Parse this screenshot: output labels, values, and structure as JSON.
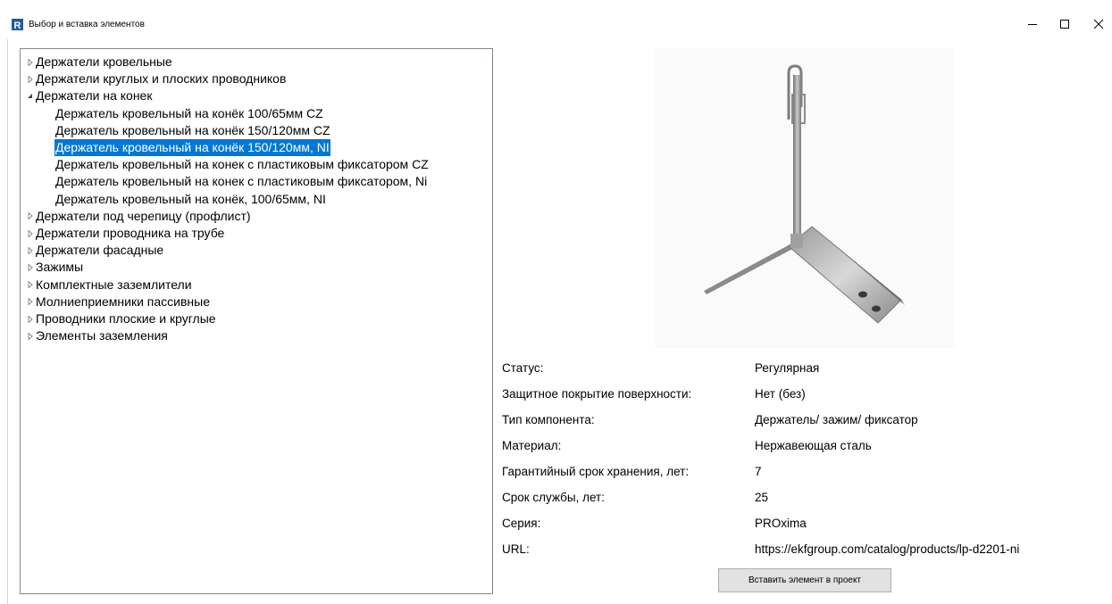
{
  "window": {
    "title": "Выбор и вставка элементов",
    "app_icon_letter": "R",
    "controls": [
      "minimize-icon",
      "maximize-icon",
      "close-icon"
    ]
  },
  "tree": {
    "items": [
      {
        "label": "Держатели кровельные",
        "expanded": false,
        "level": 0
      },
      {
        "label": "Держатели круглых и плоских проводников",
        "expanded": false,
        "level": 0
      },
      {
        "label": "Держатели на конек",
        "expanded": true,
        "level": 0
      },
      {
        "label": "Держатель кровельный на конёк 100/65мм CZ",
        "level": 1
      },
      {
        "label": "Держатель кровельный на конёк 150/120мм CZ",
        "level": 1
      },
      {
        "label": "Держатель кровельный на конёк 150/120мм, NI",
        "level": 1,
        "selected": true
      },
      {
        "label": "Держатель кровельный на конек с пластиковым фиксатором CZ",
        "level": 1
      },
      {
        "label": "Держатель кровельный на конек с пластиковым фиксатором, Ni",
        "level": 1
      },
      {
        "label": "Держатель кровельный на конёк, 100/65мм, NI",
        "level": 1
      },
      {
        "label": "Держатели под черепицу (профлист)",
        "expanded": false,
        "level": 0
      },
      {
        "label": "Держатели проводника на трубе",
        "expanded": false,
        "level": 0
      },
      {
        "label": "Держатели фасадные",
        "expanded": false,
        "level": 0
      },
      {
        "label": "Зажимы",
        "expanded": false,
        "level": 0
      },
      {
        "label": "Комплектные заземлители",
        "expanded": false,
        "level": 0
      },
      {
        "label": "Молниеприемники пассивные",
        "expanded": false,
        "level": 0
      },
      {
        "label": "Проводники плоские и круглые",
        "expanded": false,
        "level": 0
      },
      {
        "label": "Элементы заземления",
        "expanded": false,
        "level": 0
      }
    ]
  },
  "properties": [
    {
      "name": "Статус:",
      "value": "Регулярная"
    },
    {
      "name": "Защитное покрытие поверхности:",
      "value": "Нет (без)"
    },
    {
      "name": "Тип компонента:",
      "value": "Держатель/ зажим/ фиксатор"
    },
    {
      "name": "Материал:",
      "value": "Нержавеющая сталь"
    },
    {
      "name": "Гарантийный срок хранения, лет:",
      "value": "7"
    },
    {
      "name": "Срок службы, лет:",
      "value": "25"
    },
    {
      "name": "Серия:",
      "value": "PROxima"
    },
    {
      "name": "URL:",
      "value": "https://ekfgroup.com/catalog/products/lp-d2201-ni"
    }
  ],
  "actions": {
    "insert_label": "Вставить элемент в проект"
  },
  "colors": {
    "selection": "#0078d7",
    "app_icon": "#1f5aa6",
    "button_face": "#e1e1e1"
  }
}
